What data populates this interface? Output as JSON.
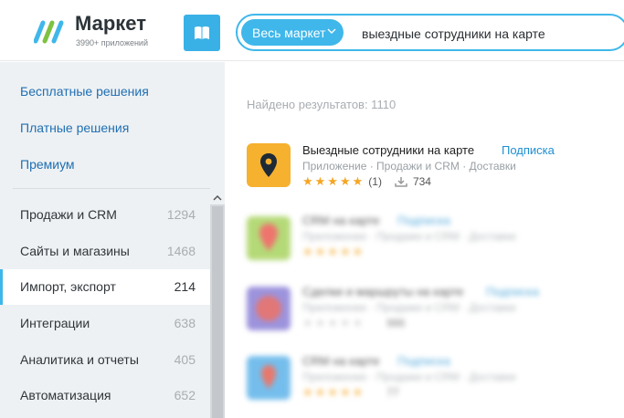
{
  "header": {
    "brand_title": "Маркет",
    "brand_subtitle": "3990+ приложений",
    "search_scope": "Весь маркет",
    "search_value": "выездные сотрудники на карте"
  },
  "sidebar": {
    "top_links": [
      "Бесплатные решения",
      "Платные решения",
      "Премиум"
    ],
    "categories": [
      {
        "label": "Продажи и CRM",
        "count": "1294"
      },
      {
        "label": "Сайты и магазины",
        "count": "1468"
      },
      {
        "label": "Импорт, экспорт",
        "count": "214",
        "active": true
      },
      {
        "label": "Интеграции",
        "count": "638"
      },
      {
        "label": "Аналитика и отчеты",
        "count": "405"
      },
      {
        "label": "Автоматизация",
        "count": "652"
      }
    ]
  },
  "results": {
    "found_label": "Найдено результатов: 1110",
    "apps": [
      {
        "name": "Выездные сотрудники на карте",
        "subscription": "Подписка",
        "meta": "Приложение · Продажи и CRM · Доставки",
        "rating_count": "(1)",
        "installs": "734"
      },
      {
        "name": "CRM на карте",
        "subscription": "Подписка",
        "meta": "Приложение · Продажи и CRM · Доставки",
        "rating_count": "",
        "installs": ""
      },
      {
        "name": "Сделки и маршруты на карте",
        "subscription": "Подписка",
        "meta": "Приложение · Продажи и CRM · Доставки",
        "rating_count": "",
        "installs": "986"
      },
      {
        "name": "CRM на карте",
        "subscription": "Подписка",
        "meta": "Приложение · Продажи и CRM · Доставки",
        "rating_count": "",
        "installs": "77"
      }
    ]
  },
  "colors": {
    "accent": "#3fb7ea",
    "link": "#1f6fb3",
    "star": "#f5a623",
    "app_icon": "#f6b12f"
  }
}
